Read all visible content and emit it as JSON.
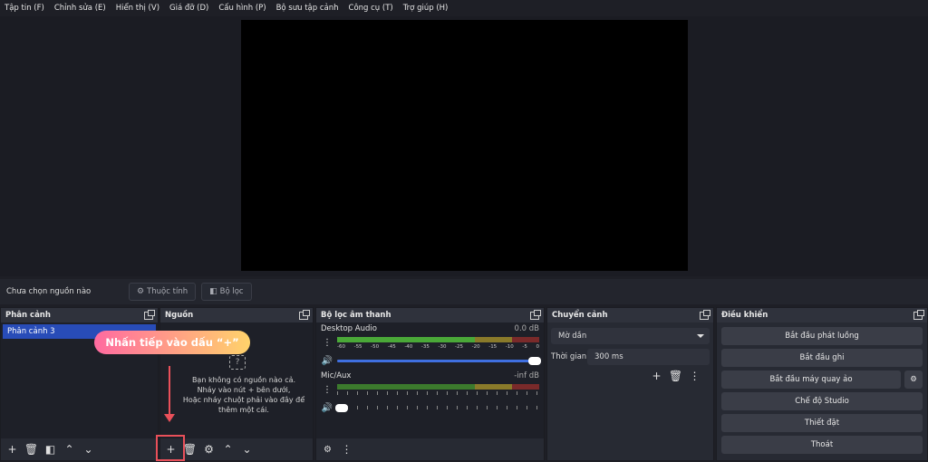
{
  "menu": [
    "Tập tin (F)",
    "Chỉnh sửa (E)",
    "Hiển thị (V)",
    "Giá đỡ (D)",
    "Cấu hình (P)",
    "Bộ sưu tập cảnh",
    "Công cụ (T)",
    "Trợ giúp (H)"
  ],
  "source_bar": {
    "no_source": "Chưa chọn nguồn nào",
    "properties": "Thuộc tính",
    "filters": "Bộ lọc"
  },
  "scenes": {
    "title": "Phân cảnh",
    "items": [
      "Phân cảnh 3"
    ]
  },
  "sources": {
    "title": "Nguồn",
    "empty_line1": "Bạn không có nguồn nào cả.",
    "empty_line2": "Nháy vào nút + bên dưới,",
    "empty_line3": "Hoặc nháy chuột phải vào đây để",
    "empty_line4": "thêm một cái."
  },
  "annotation": {
    "tooltip": "Nhấn tiếp vào dấu “+”"
  },
  "mixer": {
    "title": "Bộ lọc âm thanh",
    "scale": [
      "-60",
      "-55",
      "-50",
      "-45",
      "-40",
      "-35",
      "-30",
      "-25",
      "-20",
      "-15",
      "-10",
      "-5",
      "0"
    ],
    "channels": [
      {
        "name": "Desktop Audio",
        "db": "0.0 dB",
        "volume": 1.0
      },
      {
        "name": "Mic/Aux",
        "db": "-inf dB",
        "volume": 0.0
      }
    ]
  },
  "transitions": {
    "title": "Chuyển cảnh",
    "selected": "Mờ dần",
    "duration_label": "Thời gian",
    "duration_value": "300 ms"
  },
  "controls": {
    "title": "Điều khiển",
    "start_stream": "Bắt đầu phát luồng",
    "start_record": "Bắt đầu ghi",
    "start_virtualcam": "Bắt đầu máy quay ảo",
    "studio_mode": "Chế độ Studio",
    "settings": "Thiết đặt",
    "exit": "Thoát"
  },
  "colors": {
    "accent": "#284cb8",
    "highlight": "#e9505a",
    "tooltip_from": "#ff6aa0",
    "tooltip_to": "#ffd36b"
  }
}
